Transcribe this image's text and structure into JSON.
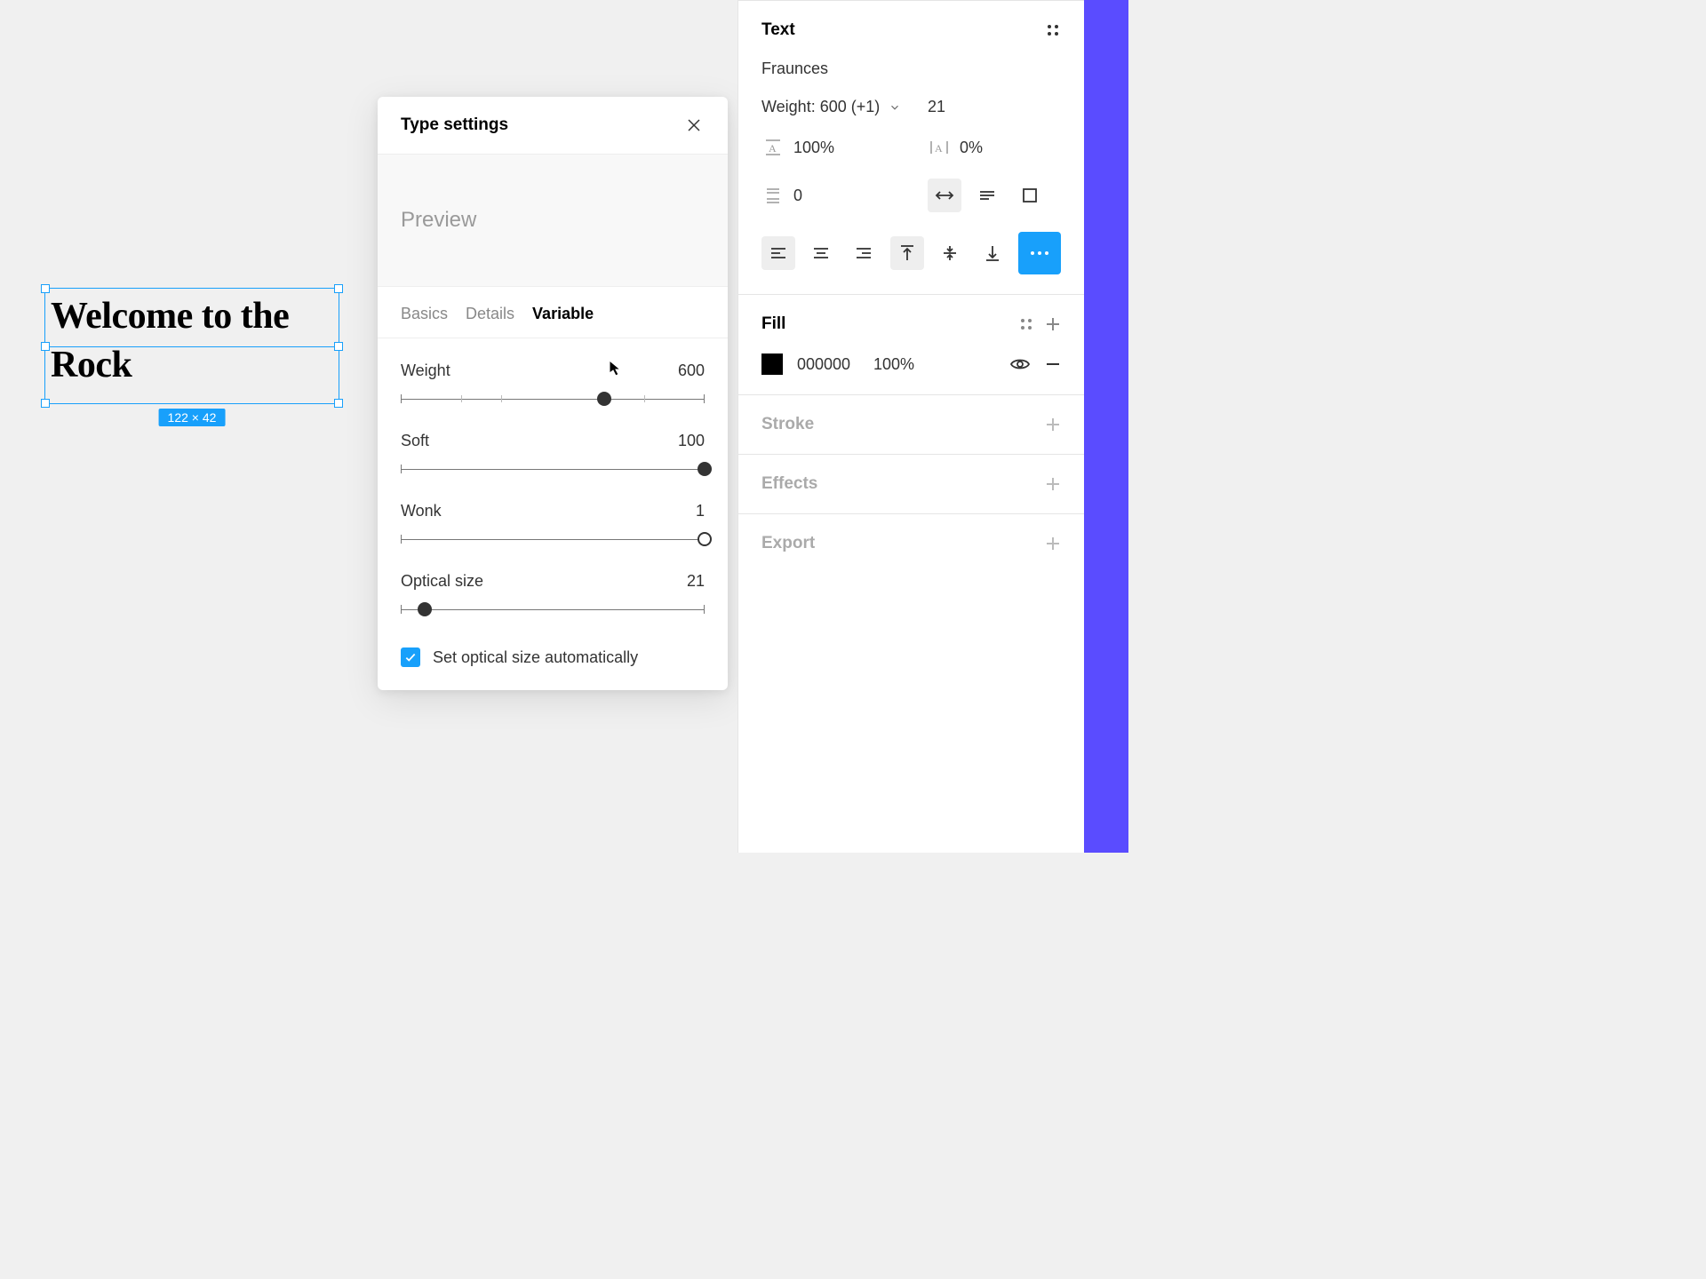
{
  "canvas": {
    "text_content": "Welcome to the Rock",
    "selection_size": "122 × 42"
  },
  "dialog": {
    "title": "Type settings",
    "preview_label": "Preview",
    "tabs": {
      "basics": "Basics",
      "details": "Details",
      "variable": "Variable"
    },
    "sliders": {
      "weight": {
        "label": "Weight",
        "value": "600",
        "percent": 67
      },
      "soft": {
        "label": "Soft",
        "value": "100",
        "percent": 100
      },
      "wonk": {
        "label": "Wonk",
        "value": "1",
        "percent": 100
      },
      "optical": {
        "label": "Optical size",
        "value": "21",
        "percent": 8
      }
    },
    "checkbox_label": "Set optical size automatically"
  },
  "panel": {
    "text": {
      "title": "Text",
      "font_name": "Fraunces",
      "weight_label": "Weight: 600 (+1)",
      "font_size": "21",
      "line_height": "100%",
      "letter_spacing": "0%",
      "paragraph_spacing": "0"
    },
    "fill": {
      "title": "Fill",
      "hex": "000000",
      "opacity": "100%"
    },
    "stroke_title": "Stroke",
    "effects_title": "Effects",
    "export_title": "Export"
  }
}
